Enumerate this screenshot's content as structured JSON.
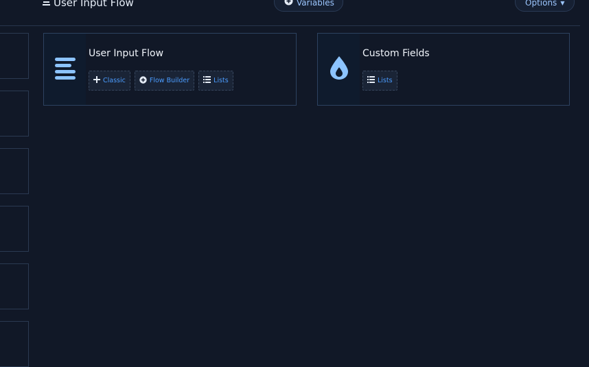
{
  "header": {
    "title": "User Input Flow",
    "variables_label": "Variables",
    "options_label": "Options"
  },
  "cards": [
    {
      "title": "User Input Flow",
      "icon": "align-left-icon",
      "buttons": [
        {
          "label": "Classic",
          "icon": "plus-icon"
        },
        {
          "label": "Flow Builder",
          "icon": "plus-circle-icon"
        },
        {
          "label": "Lists",
          "icon": "list-icon"
        }
      ]
    },
    {
      "title": "Custom Fields",
      "icon": "droplet-icon",
      "buttons": [
        {
          "label": "Lists",
          "icon": "list-icon"
        }
      ]
    }
  ],
  "colors": {
    "background": "#111827",
    "accent": "#4b9cff",
    "icon": "#8cc4ff"
  }
}
